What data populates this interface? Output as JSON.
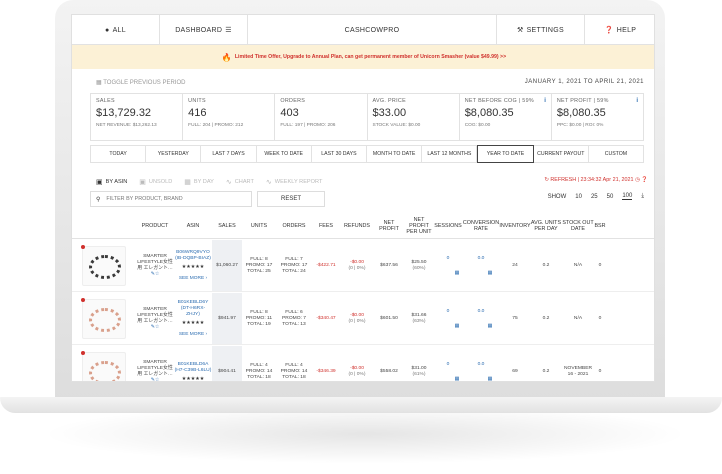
{
  "nav": {
    "all": "ALL",
    "dashboard": "DASHBOARD",
    "brand": "CASHCOWPRO",
    "settings": "SETTINGS",
    "help": "HELP"
  },
  "banner": {
    "text": "Limited Time Offer, Upgrade to Annual Plan, can get permanent member of Unicorn Smasher (value $49.99) >>"
  },
  "toggle_period": "TOGGLE PREVIOUS PERIOD",
  "date_range": "JANUARY 1, 2021 TO APRIL 21, 2021",
  "metrics": [
    {
      "label": "SALES",
      "value": "$13,729.32",
      "sub": "NET REVENUE: $13,262.13"
    },
    {
      "label": "UNITS",
      "value": "416",
      "sub": "FULL: 204 | PROMO: 212"
    },
    {
      "label": "ORDERS",
      "value": "403",
      "sub": "FULL: 197 | PROMO: 206"
    },
    {
      "label": "AVG. PRICE",
      "value": "$33.00",
      "sub": "STOCK VALUE: $0.00"
    },
    {
      "label": "NET BEFORE COG | 59%",
      "value": "$8,080.35",
      "sub": "COG: $0.00"
    },
    {
      "label": "NET PROFIT | 59%",
      "value": "$8,080.35",
      "sub": "PPC: $0.00 | ROI: 0%"
    }
  ],
  "periods": [
    "TODAY",
    "YESTERDAY",
    "LAST 7 DAYS",
    "WEEK TO DATE",
    "LAST 30 DAYS",
    "MONTH TO DATE",
    "LAST 12 MONTHS",
    "YEAR TO DATE",
    "CURRENT PAYOUT",
    "CUSTOM"
  ],
  "active_period": "YEAR TO DATE",
  "views": [
    "BY ASIN",
    "UNSOLD",
    "BY DAY",
    "CHART",
    "WEEKLY REPORT"
  ],
  "refresh": "REFRESH | 23:34:32 Apr 21, 2021",
  "filter_placeholder": "FILTER BY PRODUCT, BRAND",
  "reset": "RESET",
  "show": {
    "label": "SHOW",
    "options": [
      "10",
      "25",
      "50",
      "100"
    ],
    "selected": "100"
  },
  "columns": [
    "PRODUCT",
    "ASIN",
    "SALES",
    "UNITS",
    "ORDERS",
    "FEES",
    "REFUNDS",
    "NET PROFIT",
    "NET PROFIT PER UNIT",
    "SESSIONS",
    "CONVERSION RATE",
    "INVENTORY",
    "AVG. UNITS PER DAY",
    "STOCK OUT DATE",
    "BSR"
  ],
  "rows": [
    {
      "product": "SMARTER LIFESTYLE女性用 エレガント…",
      "asin": "B06WRQ9VYO (IB-DQBP-BIAZ)",
      "stars": "★★★★★",
      "see_more": "SEE MORE ›",
      "sales": "$1,060.27",
      "units": "FULL: 8 PROMO: 17 TOTAL: 25",
      "orders": "FULL: 7 PROMO: 17 TOTAL: 24",
      "fees": "-$422.71",
      "refunds": "-$0.00",
      "refunds_sub": "(0 | 0%)",
      "net_profit": "$637.56",
      "np_per_unit": "$25.50",
      "np_pct": "(60%)",
      "sessions": "0",
      "conversion": "0.0",
      "inventory": "24",
      "avg_units": "0.2",
      "stock_out": "N/A",
      "bsr": "0"
    },
    {
      "product": "SMARTER LIFESTYLE女性用 エレガント…",
      "asin": "B01KEBLD6Y (DT-H6RX-ZHJY)",
      "stars": "★★★★★",
      "see_more": "SEE MORE ›",
      "sales": "$941.97",
      "units": "FULL: 8 PROMO: 11 TOTAL: 19",
      "orders": "FULL: 6 PROMO: 7 TOTAL: 13",
      "fees": "-$340.47",
      "refunds": "-$0.00",
      "refunds_sub": "(0 | 0%)",
      "net_profit": "$601.50",
      "np_per_unit": "$31.66",
      "np_pct": "(63%)",
      "sessions": "0",
      "conversion": "0.0",
      "inventory": "75",
      "avg_units": "0.2",
      "stock_out": "N/A",
      "bsr": "0"
    },
    {
      "product": "SMARTER LIFESTYLE女性用 エレガント…",
      "asin": "B01KEBLD6A (H7-C39B-L6LU)",
      "stars": "★★★★★",
      "see_more": "",
      "sales": "$904.41",
      "units": "FULL: 4 PROMO: 14 TOTAL: 18",
      "orders": "FULL: 4 PROMO: 14 TOTAL: 18",
      "fees": "-$346.39",
      "refunds": "-$0.00",
      "refunds_sub": "(0 | 0%)",
      "net_profit": "$558.02",
      "np_per_unit": "$31.00",
      "np_pct": "(61%)",
      "sessions": "0",
      "conversion": "0.0",
      "inventory": "69",
      "avg_units": "0.2",
      "stock_out": "NOVEMBER 16 - 2021",
      "bsr": "0"
    }
  ]
}
